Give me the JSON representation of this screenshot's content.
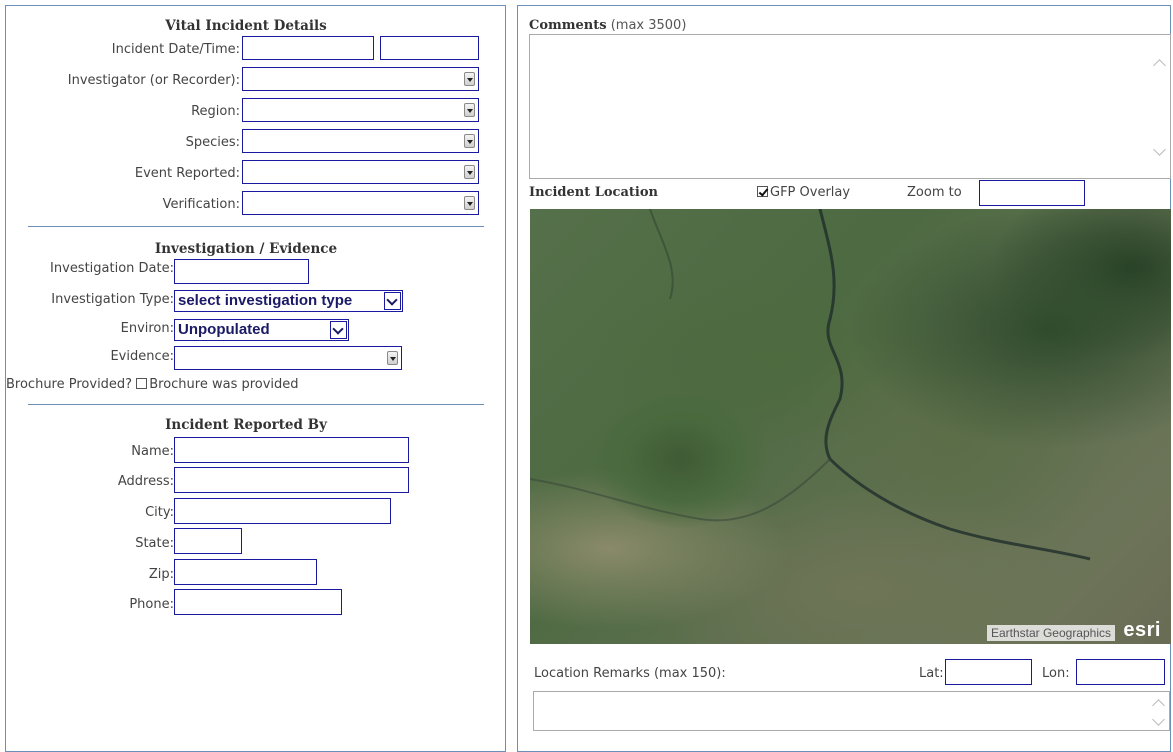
{
  "vital": {
    "title": "Vital Incident Details",
    "date_label": "Incident Date/Time:",
    "investigator_label": "Investigator (or Recorder):",
    "region_label": "Region:",
    "species_label": "Species:",
    "event_label": "Event Reported:",
    "verification_label": "Verification:"
  },
  "investigation": {
    "title": "Investigation / Evidence",
    "date_label": "Investigation Date:",
    "type_label": "Investigation Type:",
    "type_value": "select investigation type",
    "environ_label": "Environ:",
    "environ_value": "Unpopulated",
    "evidence_label": "Evidence:",
    "brochure_label": "Brochure Provided?",
    "brochure_checkbox_label": "Brochure was provided"
  },
  "reported_by": {
    "title": "Incident Reported By",
    "name_label": "Name:",
    "address_label": "Address:",
    "city_label": "City:",
    "state_label": "State:",
    "zip_label": "Zip:",
    "phone_label": "Phone:"
  },
  "comments": {
    "label": "Comments",
    "max_note": "(max 3500)"
  },
  "location": {
    "title": "Incident Location",
    "overlay_label": "GFP Overlay",
    "overlay_checked": true,
    "zoom_label": "Zoom to",
    "attribution": "Earthstar Geographics",
    "logo": "esri",
    "remarks_label": "Location Remarks (max 150):",
    "lat_label": "Lat:",
    "lon_label": "Lon:"
  },
  "colors": {
    "border": "#6b8fb8",
    "input_border": "#1a1aa0"
  }
}
